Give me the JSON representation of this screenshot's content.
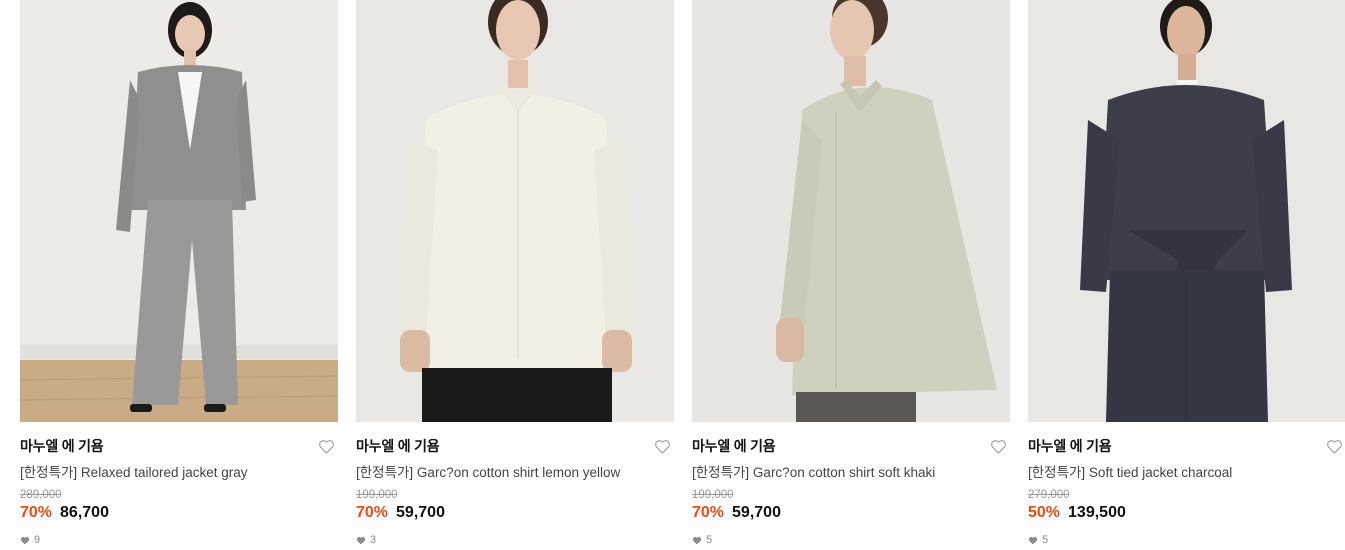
{
  "products": [
    {
      "brand": "마누엘 에 기욤",
      "name": "[한정특가] Relaxed tailored jacket gray",
      "original_price": "289,000",
      "discount": "70%",
      "price": "86,700",
      "likes": "9",
      "image_alt": "Model wearing gray tailored suit"
    },
    {
      "brand": "마누엘 에 기욤",
      "name": "[한정특가] Garc?on cotton shirt lemon yellow",
      "original_price": "199,000",
      "discount": "70%",
      "price": "59,700",
      "likes": "3",
      "image_alt": "Model wearing cream cotton shirt"
    },
    {
      "brand": "마누엘 에 기욤",
      "name": "[한정특가] Garc?on cotton shirt soft khaki",
      "original_price": "199,000",
      "discount": "70%",
      "price": "59,700",
      "likes": "5",
      "image_alt": "Model wearing khaki cotton shirt"
    },
    {
      "brand": "마누엘 에 기욤",
      "name": "[한정특가] Soft tied jacket charcoal",
      "original_price": "279,000",
      "discount": "50%",
      "price": "139,500",
      "likes": "5",
      "image_alt": "Model wearing charcoal tied jacket"
    }
  ],
  "colors": {
    "discount": "#f04b0f",
    "text": "#111111",
    "muted": "#9a9a9a"
  },
  "icons": {
    "wishlist": "heart-outline-icon",
    "likes": "heart-filled-icon"
  }
}
